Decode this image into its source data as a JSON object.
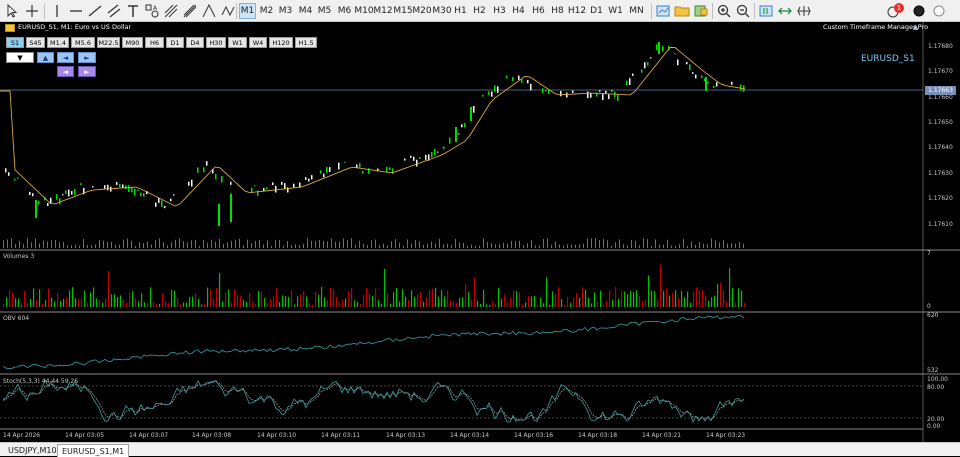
{
  "toolbar": {
    "timeframes": [
      "M1",
      "M2",
      "M3",
      "M4",
      "M5",
      "M6",
      "M10",
      "M12",
      "M15",
      "M20",
      "M30",
      "H1",
      "H2",
      "H3",
      "H4",
      "H6",
      "H8",
      "H12",
      "D1",
      "W1",
      "MN"
    ],
    "active_timeframe": "M1",
    "notification_count": "1"
  },
  "chart": {
    "title": "EURUSD_S1, M1:  Euro vs US Dollar",
    "symbol_label": "EURUSD_S1",
    "tool_label": "Custom Timeframe Manager Pro",
    "current_price": "1.17663",
    "price_labels": [
      "1.17680",
      "1.17670",
      "1.17660",
      "1.17650",
      "1.17640",
      "1.17630",
      "1.17620",
      "1.17610"
    ],
    "custom_timeframes": [
      "S1",
      "S45",
      "M1.4",
      "M5.6",
      "M22.5",
      "M90",
      "H6",
      "D1",
      "D4",
      "H30",
      "W1",
      "W4",
      "H120",
      "H1.5"
    ],
    "active_custom_timeframe": "S1",
    "arrows_row1": [
      "▼",
      "▲",
      "◄",
      "►"
    ],
    "arrows_row2": [
      "◄",
      "►"
    ],
    "time_labels": [
      "14 Apr 2026",
      "14 Apr 03:05",
      "14 Apr 03:07",
      "14 Apr 03:08",
      "14 Apr 03:10",
      "14 Apr 03:11",
      "14 Apr 03:13",
      "14 Apr 03:14",
      "14 Apr 03:16",
      "14 Apr 03:18",
      "14 Apr 03:21",
      "14 Apr 03:23"
    ]
  },
  "volumes": {
    "label": "Volumes 3",
    "scale_top": "7",
    "scale_bottom": "0"
  },
  "obv": {
    "label": "OBV 604",
    "scale_top": "620",
    "scale_bottom": "532"
  },
  "stoch": {
    "label": "Stoch(5,3,3) 44.44 59.26",
    "scale": [
      "100.00",
      "80.00",
      "20.00",
      "0.00"
    ]
  },
  "tabs": [
    "USDJPY,M10",
    "EURUSD_S1,M1"
  ],
  "colors": {
    "bull": "#00e000",
    "ma": "#d6a93a",
    "obv": "#3aa0a0",
    "stoch_main": "#3aa0a0",
    "stoch_signal": "#c0c0c0",
    "vol_up": "#00c000",
    "vol_down": "#c00000"
  }
}
